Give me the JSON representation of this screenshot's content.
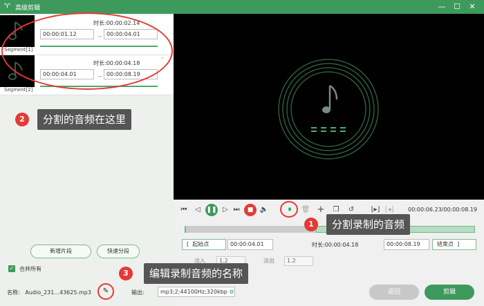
{
  "window": {
    "title": "高级剪辑",
    "minimize": "—",
    "maximize": "☐",
    "close": "✕"
  },
  "segments": [
    {
      "label": "Segment[1]",
      "duration_label": "时长:00:00:02.14",
      "start": "00:00:01.12",
      "end": "00:00:04.01"
    },
    {
      "label": "Segment[2]",
      "duration_label": "时长:00:00:04.18",
      "start": "00:00:04.01",
      "end": "00:00:08.19"
    }
  ],
  "callouts": [
    {
      "num": "2",
      "text": "分割的音频在这里"
    },
    {
      "num": "1",
      "text": "分割录制的音频"
    },
    {
      "num": "3",
      "text": "编辑录制音频的名称"
    }
  ],
  "left_buttons": {
    "add_segment": "新增片段",
    "quick_split": "快速分段"
  },
  "merge_all": "合并所有",
  "player": {
    "time_readout": "00:00:06.23/00:00:08.19",
    "start_label": "起始点",
    "start_value": "00:00:04.01",
    "duration_label": "时长:00:00:04.18",
    "end_value": "00:00:08.19",
    "end_label": "结束点",
    "fade_in": "淡入",
    "fade_in_value": "1.2",
    "fade_out": "淡出",
    "fade_out_value": "1.2"
  },
  "footer": {
    "name_label": "名称:",
    "name_value": "Audio_231...43625.mp3",
    "output_label": "输出:",
    "output_value": "mp3;2;44100Hz;320kbp",
    "back": "返回",
    "cut": "剪辑"
  },
  "colors": {
    "brand": "#3d9a5c",
    "callout_badge": "#e53935",
    "stop": "#e53935"
  }
}
